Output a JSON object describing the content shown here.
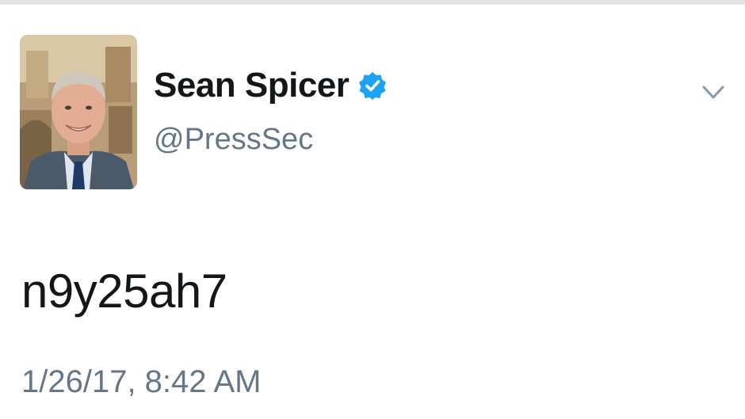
{
  "tweet": {
    "author": {
      "display_name": "Sean Spicer",
      "handle": "@PressSec",
      "verified": true,
      "verified_icon": "verified-badge-icon",
      "avatar": "profile-photo"
    },
    "text": "n9y25ah7",
    "timestamp": "1/26/17, 8:42 AM",
    "menu_icon": "chevron-down-icon"
  },
  "colors": {
    "text_primary": "#14171a",
    "text_secondary": "#657786",
    "verified_blue": "#1da1f2",
    "caret_gray": "#8899a6"
  }
}
